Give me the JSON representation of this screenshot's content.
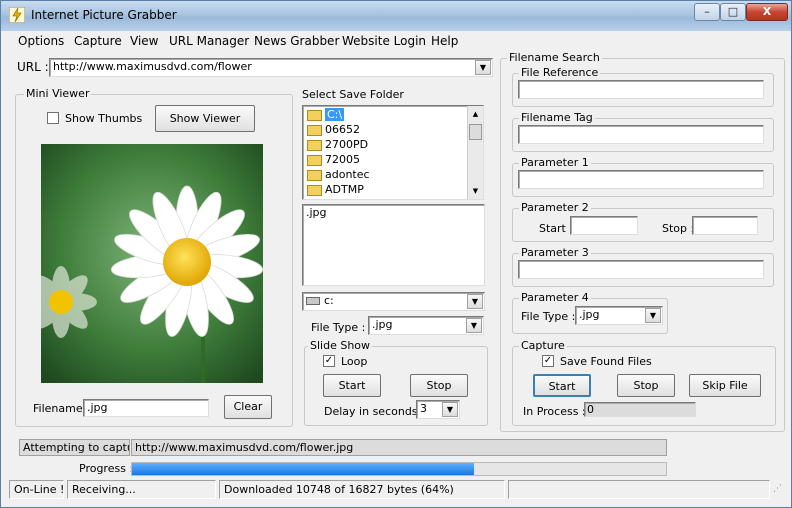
{
  "window": {
    "title": "Internet Picture Grabber",
    "controls": {
      "minimize": "–",
      "maximize": "□",
      "close": "X"
    }
  },
  "menu": [
    "Options",
    "Capture",
    "View",
    "URL Manager",
    "News Grabber",
    "Website Login",
    "Help"
  ],
  "url": {
    "label": "URL :",
    "value": "http://www.maximusdvd.com/flower"
  },
  "mini_viewer": {
    "title": "Mini Viewer",
    "show_thumbs_label": "Show Thumbs",
    "show_thumbs_checked": false,
    "show_viewer_button": "Show Viewer",
    "filename_label": "Filename :",
    "filename_value": ".jpg",
    "clear_button": "Clear"
  },
  "save_folder": {
    "title": "Select Save Folder",
    "folders": [
      "C:\\",
      "06652",
      "2700PD",
      "72005",
      "adontec",
      "ADTMP"
    ],
    "selected_index": 0,
    "file_list": [
      ".jpg"
    ],
    "drive": "c:",
    "file_type_label": "File Type :",
    "file_type_value": ".jpg"
  },
  "slide_show": {
    "title": "Slide Show",
    "loop_label": "Loop",
    "loop_checked": true,
    "start_button": "Start",
    "stop_button": "Stop",
    "delay_label": "Delay in seconds :",
    "delay_value": "3"
  },
  "filename_search": {
    "title": "Filename Search",
    "file_reference": {
      "title": "File Reference",
      "value": ""
    },
    "filename_tag": {
      "title": "Filename Tag",
      "value": ""
    },
    "parameter1": {
      "title": "Parameter 1",
      "value": ""
    },
    "parameter2": {
      "title": "Parameter 2",
      "start_label": "Start :",
      "start_value": "",
      "stop_label": "Stop :",
      "stop_value": ""
    },
    "parameter3": {
      "title": "Parameter 3",
      "value": ""
    },
    "parameter4": {
      "title": "Parameter 4",
      "file_type_label": "File Type :",
      "file_type_value": ".jpg"
    }
  },
  "capture": {
    "title": "Capture",
    "save_found_label": "Save Found Files",
    "save_found_checked": true,
    "start_button": "Start",
    "stop_button": "Stop",
    "skip_button": "Skip File",
    "in_process_label": "In Process :",
    "in_process_value": "0"
  },
  "attempt": {
    "label": "Attempting to capture :",
    "value": "http://www.maximusdvd.com/flower.jpg"
  },
  "progress": {
    "label": "Progress :",
    "fraction": 0.64
  },
  "status": {
    "online": "On-Line !",
    "receiving": "Receiving...",
    "downloaded": "Downloaded 10748 of 16827 bytes  (64%)"
  },
  "colors": {
    "progress": "#1979e0",
    "selection": "#3399ff"
  }
}
